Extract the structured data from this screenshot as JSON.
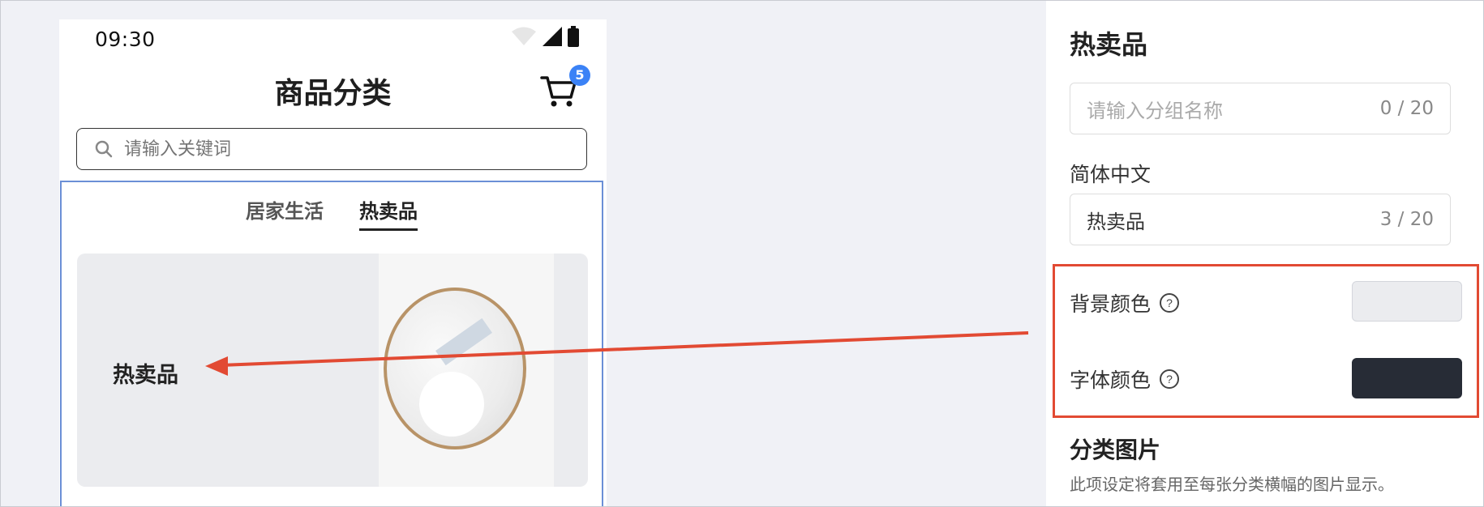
{
  "phone": {
    "status_time": "09:30",
    "page_title": "商品分类",
    "cart_badge": "5",
    "search_placeholder": "请输入关键词",
    "tabs": [
      {
        "label": "居家生活",
        "active": false
      },
      {
        "label": "热卖品",
        "active": true
      }
    ],
    "banner_text": "热卖品",
    "banner_bg_color": "#ebecef",
    "banner_font_color": "#272c36"
  },
  "panel": {
    "title": "热卖品",
    "group_name_placeholder": "请输入分组名称",
    "group_name_count": "0 / 20",
    "simplified_chinese_label": "简体中文",
    "simplified_chinese_value": "热卖品",
    "simplified_chinese_count": "3 / 20",
    "bg_color_label": "背景颜色",
    "bg_color_value": "#ebecef",
    "font_color_label": "字体颜色",
    "font_color_value": "#272c36",
    "category_image_title": "分类图片",
    "category_image_desc": "此项设定将套用至每张分类横幅的图片显示。"
  },
  "colors": {
    "accent_blue": "#3b82f6",
    "frame_blue": "#6b8fd6",
    "annotation_red": "#e24a33"
  }
}
